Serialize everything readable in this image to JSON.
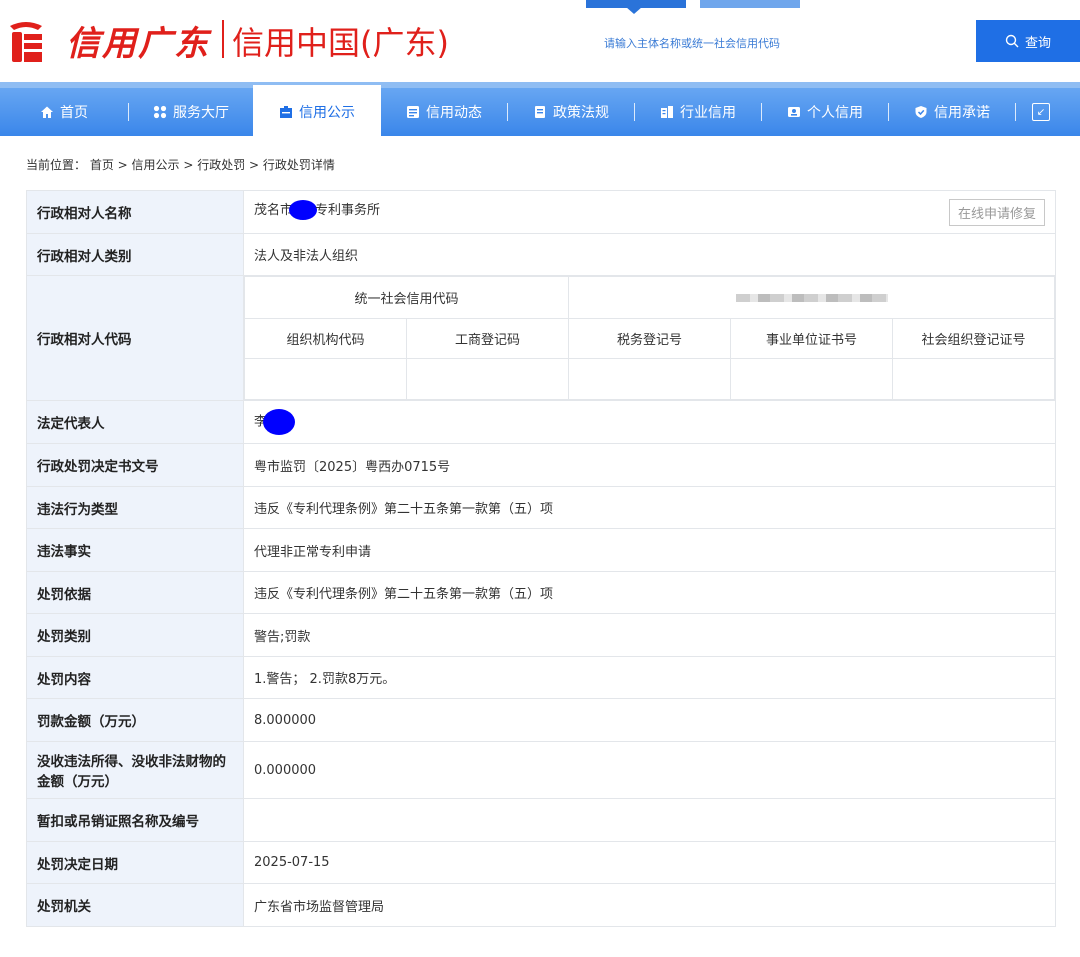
{
  "header": {
    "logo_script": "信用广东",
    "site_title": "信用中国(广东)",
    "search_placeholder": "请输入主体名称或统一社会信用代码",
    "search_button": "查询",
    "accent_color": "#1f6fe5",
    "brand_color": "#e0201b"
  },
  "nav": {
    "items": [
      {
        "label": "首页",
        "icon": "home-icon"
      },
      {
        "label": "服务大厅",
        "icon": "grid-icon"
      },
      {
        "label": "信用公示",
        "icon": "briefcase-icon",
        "active": true
      },
      {
        "label": "信用动态",
        "icon": "news-icon"
      },
      {
        "label": "政策法规",
        "icon": "document-icon"
      },
      {
        "label": "行业信用",
        "icon": "building-icon"
      },
      {
        "label": "个人信用",
        "icon": "id-card-icon"
      },
      {
        "label": "信用承诺",
        "icon": "shield-check-icon"
      }
    ]
  },
  "breadcrumb": {
    "prefix": "当前位置：",
    "path": "首页 > 信用公示 > 行政处罚 > 行政处罚详情"
  },
  "detail": {
    "name_label": "行政相对人名称",
    "name_value_prefix": "茂名市",
    "name_value_suffix": "专利事务所",
    "repair_button": "在线申请修复",
    "category_label": "行政相对人类别",
    "category_value": "法人及非法人组织",
    "code_label": "行政相对人代码",
    "code_headers": {
      "uscc": "统一社会信用代码",
      "org_code": "组织机构代码",
      "biz_reg": "工商登记码",
      "tax_reg": "税务登记号",
      "institution": "事业单位证书号",
      "social_org": "社会组织登记证号"
    },
    "legal_rep_label": "法定代表人",
    "legal_rep_value": "李",
    "rows": [
      {
        "label": "行政处罚决定书文号",
        "value": "粤市监罚〔2025〕粤西办0715号"
      },
      {
        "label": "违法行为类型",
        "value": "违反《专利代理条例》第二十五条第一款第（五）项"
      },
      {
        "label": "违法事实",
        "value": "代理非正常专利申请"
      },
      {
        "label": "处罚依据",
        "value": "违反《专利代理条例》第二十五条第一款第（五）项"
      },
      {
        "label": "处罚类别",
        "value": "警告;罚款"
      },
      {
        "label": "处罚内容",
        "value": "1.警告； 2.罚款8万元。"
      },
      {
        "label": "罚款金额（万元）",
        "value": "8.000000"
      },
      {
        "label": "没收违法所得、没收非法财物的金额（万元）",
        "value": "0.000000"
      },
      {
        "label": "暂扣或吊销证照名称及编号",
        "value": ""
      },
      {
        "label": "处罚决定日期",
        "value": "2025-07-15"
      },
      {
        "label": "处罚机关",
        "value": "广东省市场监督管理局"
      }
    ]
  }
}
